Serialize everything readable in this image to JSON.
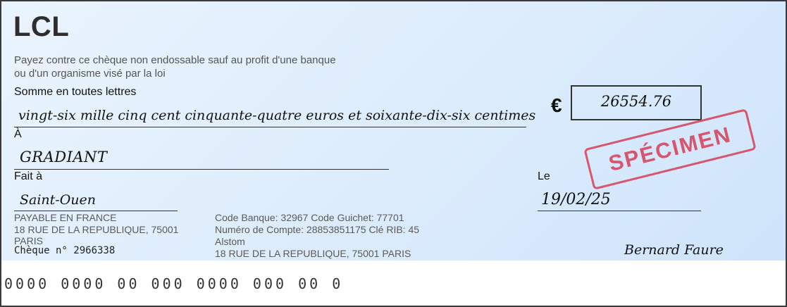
{
  "bank": {
    "name": "LCL",
    "notice": "Payez contre ce chèque non endossable sauf au profit d'une banque ou d'un organisme visé par la loi"
  },
  "labels": {
    "amount_words": "Somme en toutes lettres",
    "payee": "À",
    "place": "Fait à",
    "date": "Le"
  },
  "cheque": {
    "amount_words": "vingt-six mille cinq cent cinquante-quatre euros et soixante-dix-six centimes",
    "currency_symbol": "€",
    "amount": "26554.76",
    "payee": "GRADIANT",
    "place": "Saint-Ouen",
    "date": "19/02/25",
    "stamp": "SPÉCIMEN",
    "signature": "Bernard Faure",
    "number_label": "Chèque n° 2966338",
    "micr": "0000 0000 00 000 0000 000 00 0"
  },
  "payable": {
    "line1": "PAYABLE EN FRANCE",
    "line2": "18 RUE DE LA REPUBLIQUE, 75001",
    "line3": "PARIS"
  },
  "account": {
    "codes": "Code Banque: 32967 Code Guichet: 77701",
    "account_number": "Numéro de Compte: 28853851175 Clé RIB: 45",
    "holder": "Alstom",
    "address": "18 RUE DE LA REPUBLIQUE, 75001 PARIS"
  },
  "colors": {
    "background_start": "#eaf4fe",
    "background_end": "#cfe4fb",
    "stamp": "#d9435a",
    "border": "#3a3a3a"
  }
}
